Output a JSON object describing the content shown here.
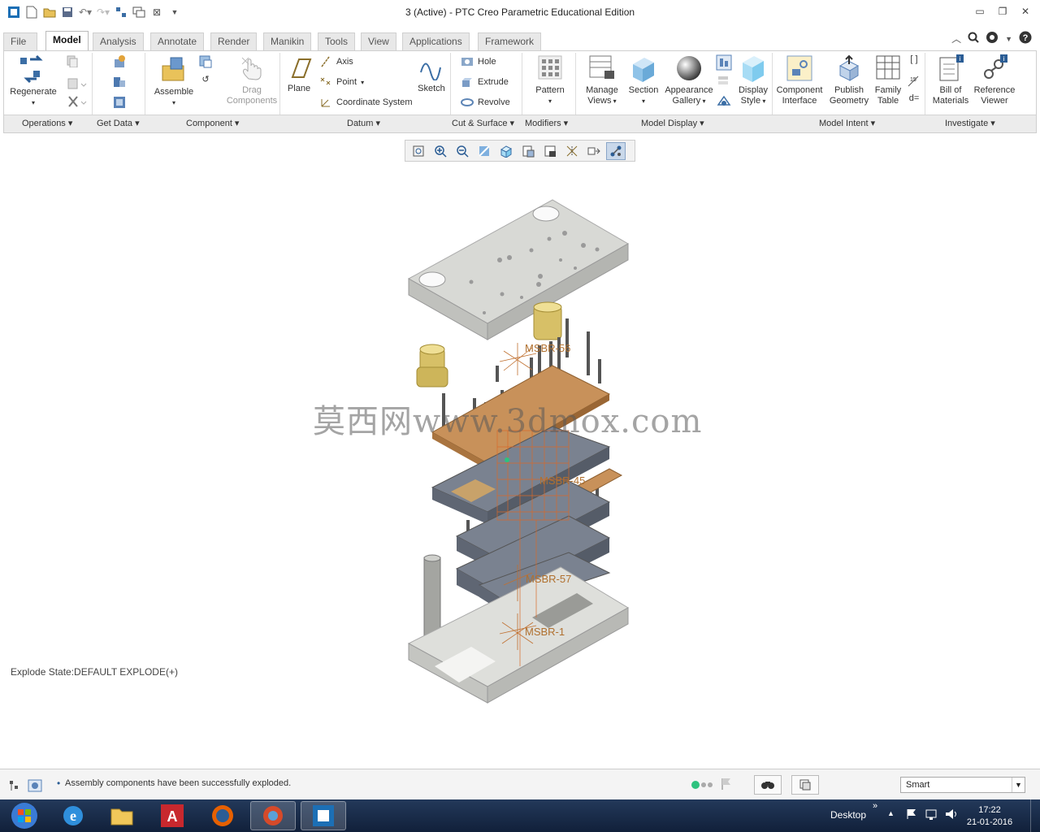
{
  "window": {
    "title": "3 (Active) - PTC Creo Parametric Educational Edition"
  },
  "tabs": [
    {
      "label": "File"
    },
    {
      "label": "Model"
    },
    {
      "label": "Analysis"
    },
    {
      "label": "Annotate"
    },
    {
      "label": "Render"
    },
    {
      "label": "Manikin"
    },
    {
      "label": "Tools"
    },
    {
      "label": "View"
    },
    {
      "label": "Applications"
    },
    {
      "label": "Framework"
    }
  ],
  "ribbon": {
    "regenerate": "Regenerate",
    "assemble": "Assemble",
    "drag_components_1": "Drag",
    "drag_components_2": "Components",
    "plane": "Plane",
    "axis": "Axis",
    "point": "Point",
    "coordinate_system": "Coordinate System",
    "sketch": "Sketch",
    "hole": "Hole",
    "extrude": "Extrude",
    "revolve": "Revolve",
    "pattern": "Pattern",
    "manage_views_1": "Manage",
    "manage_views_2": "Views",
    "section": "Section",
    "appearance_gallery_1": "Appearance",
    "appearance_gallery_2": "Gallery",
    "display_style_1": "Display",
    "display_style_2": "Style",
    "component_interface_1": "Component",
    "component_interface_2": "Interface",
    "publish_geometry_1": "Publish",
    "publish_geometry_2": "Geometry",
    "family_table_1": "Family",
    "family_table_2": "Table",
    "bill_of_materials_1": "Bill of",
    "bill_of_materials_2": "Materials",
    "reference_viewer_1": "Reference",
    "reference_viewer_2": "Viewer"
  },
  "groups": [
    {
      "label": "Operations"
    },
    {
      "label": "Get Data"
    },
    {
      "label": "Component"
    },
    {
      "label": "Datum"
    },
    {
      "label": "Cut & Surface"
    },
    {
      "label": "Modifiers"
    },
    {
      "label": "Model Display"
    },
    {
      "label": "Model Intent"
    },
    {
      "label": "Investigate"
    }
  ],
  "canvas": {
    "explode_state": "Explode State:DEFAULT EXPLODE(+)",
    "watermark": "莫西网www.3dmox.com",
    "labels": [
      "MSBR-56",
      "MSBR-45",
      "MSBR-57",
      "MSBR-1"
    ]
  },
  "status": {
    "message": "Assembly components have been successfully exploded.",
    "filter": "Smart"
  },
  "taskbar": {
    "desktop_label": "Desktop",
    "time": "17:22",
    "date": "21-01-2016"
  },
  "colors": {
    "ribbon_bg": "#ffffff",
    "group_bar": "#ececec",
    "plate_gray": "#d6d7d3",
    "plate_steel": "#7a8290",
    "plate_copper": "#c8915a",
    "brass": "#d7c067",
    "taskbar": "#1a2c4a"
  }
}
